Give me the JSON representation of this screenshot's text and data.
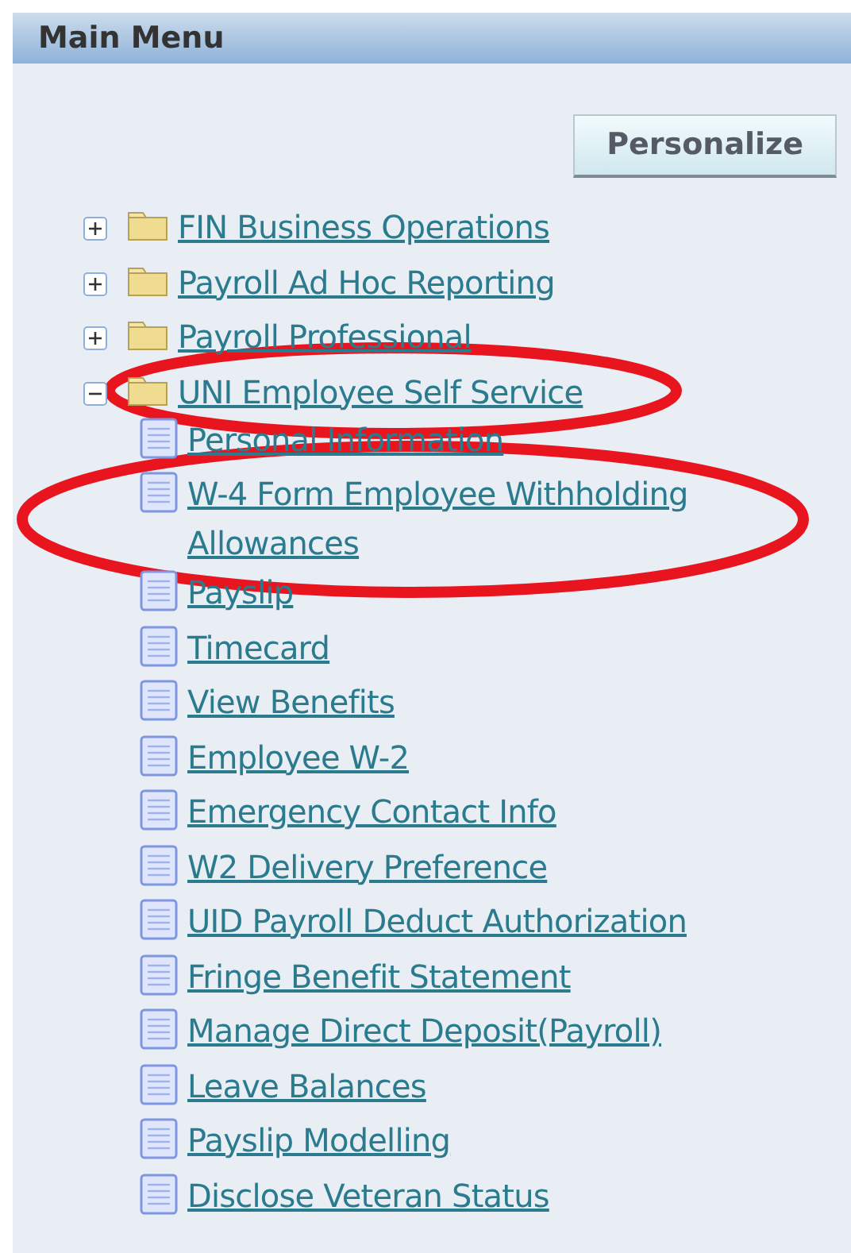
{
  "panel": {
    "title": "Main Menu"
  },
  "personalize_button": "Personalize",
  "tree": [
    {
      "label": "FIN Business  Operations",
      "expanded": false,
      "highlighted": false
    },
    {
      "label": "Payroll Ad Hoc Reporting",
      "expanded": false,
      "highlighted": false
    },
    {
      "label": "Payroll Professional",
      "expanded": false,
      "highlighted": false
    },
    {
      "label": "UNI Employee Self Service",
      "expanded": true,
      "highlighted": true,
      "children": [
        {
          "label": "Personal Information",
          "highlighted": false
        },
        {
          "label": "W-4 Form Employee Withholding Allowances",
          "highlighted": true
        },
        {
          "label": "Payslip",
          "highlighted": false
        },
        {
          "label": "Timecard",
          "highlighted": false
        },
        {
          "label": "View Benefits",
          "highlighted": false
        },
        {
          "label": "Employee W-2",
          "highlighted": false
        },
        {
          "label": "Emergency Contact Info",
          "highlighted": false
        },
        {
          "label": "W2 Delivery Preference",
          "highlighted": false
        },
        {
          "label": "UID Payroll Deduct Authorization",
          "highlighted": false
        },
        {
          "label": "Fringe Benefit Statement",
          "highlighted": false
        },
        {
          "label": "Manage Direct Deposit(Payroll)",
          "highlighted": false
        },
        {
          "label": "Leave Balances",
          "highlighted": false
        },
        {
          "label": "Payslip Modelling",
          "highlighted": false
        },
        {
          "label": "Disclose Veteran Status",
          "highlighted": false
        }
      ]
    }
  ]
}
